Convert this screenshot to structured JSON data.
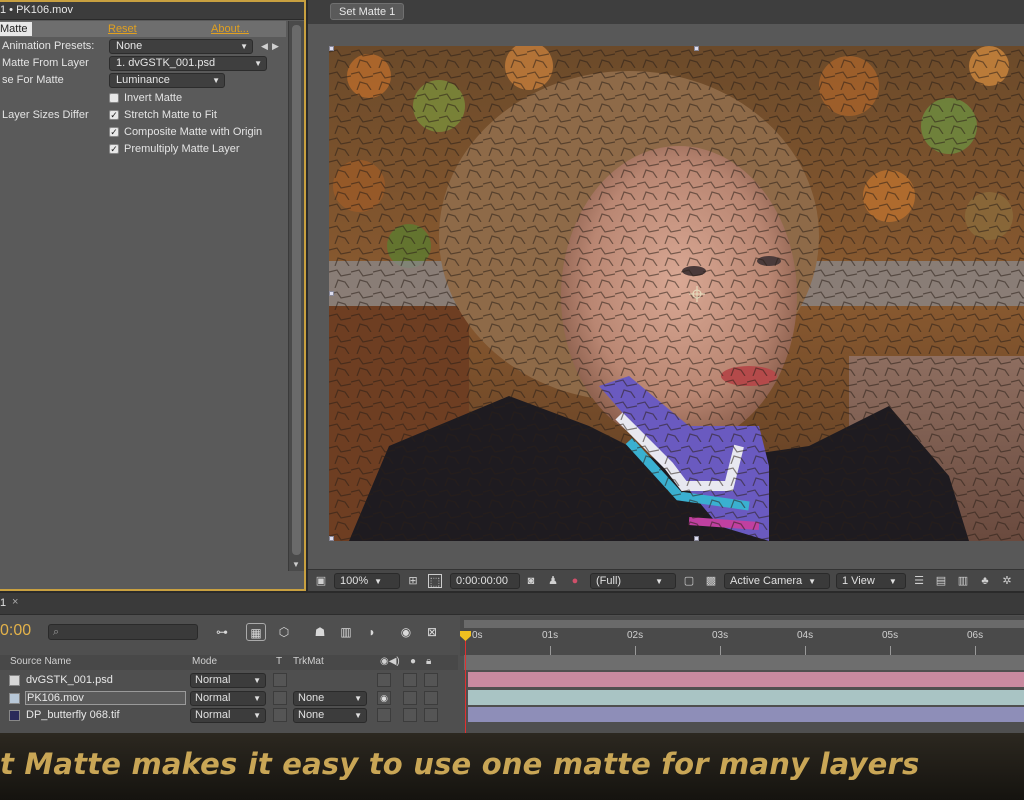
{
  "effect_controls": {
    "tab_title": "1 • PK106.mov",
    "effect_name": "Matte",
    "reset_label": "Reset",
    "about_label": "About...",
    "rows": {
      "animation_presets_label": "Animation Presets:",
      "animation_presets_value": "None",
      "matte_from_layer_label": "Matte From Layer",
      "matte_from_layer_value": "1. dvGSTK_001.psd",
      "use_for_matte_label": "se For Matte",
      "use_for_matte_value": "Luminance",
      "invert_matte_label": "Invert Matte",
      "layer_sizes_label": "Layer Sizes Differ",
      "stretch_label": "Stretch Matte to Fit",
      "composite_label": "Composite Matte with Origin",
      "premultiply_label": "Premultiply Matte Layer"
    },
    "checks": {
      "invert": false,
      "stretch": true,
      "composite": true,
      "premultiply": true
    }
  },
  "composition": {
    "tab_label": "Set Matte 1",
    "footer": {
      "zoom": "100%",
      "timecode": "0:00:00:00",
      "resolution": "(Full)",
      "camera": "Active Camera",
      "views": "1 View"
    }
  },
  "timeline": {
    "tab_label": "1",
    "timecode": "0:00",
    "search_placeholder": "",
    "columns": {
      "source_name": "Source Name",
      "mode": "Mode",
      "t": "T",
      "trkmat": "TrkMat"
    },
    "ruler_ticks": [
      "0s",
      "01s",
      "02s",
      "03s",
      "04s",
      "05s",
      "06s"
    ],
    "layers": [
      {
        "name": "dvGSTK_001.psd",
        "mode": "Normal",
        "trkmat": "",
        "color": "#c98aa0"
      },
      {
        "name": "PK106.mov",
        "mode": "Normal",
        "trkmat": "None",
        "color": "#a9c4c4"
      },
      {
        "name": "DP_butterfly 068.tif",
        "mode": "Normal",
        "trkmat": "None",
        "color": "#8e8eb8"
      }
    ]
  },
  "caption": {
    "text": "t Matte makes it easy to use one matte for many layers"
  },
  "colors": {
    "accent": "#c8a040",
    "timecode": "#e3b24a",
    "link": "#e0a020",
    "playhead": "#e03030"
  }
}
